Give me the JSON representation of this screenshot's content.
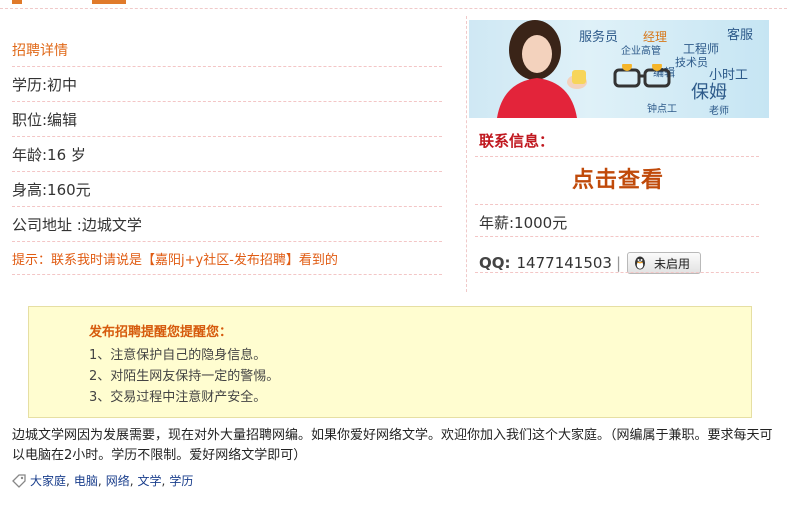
{
  "details": {
    "section_title": "招聘详情",
    "education": "学历:初中",
    "position": "职位:编辑",
    "age": "年龄:16 岁",
    "height": "身高:160元",
    "address": "公司地址 :边城文学",
    "tip_prefix": "提示：联系我时请说是",
    "tip_highlight": "【嘉阳j+y社区-发布招聘】",
    "tip_suffix": "看到的"
  },
  "banner": {
    "words": [
      "服务员",
      "经理",
      "客服",
      "工程师",
      "企业高管",
      "技术员",
      "编辑",
      "小时工",
      "保姆",
      "钟点工",
      "老师"
    ]
  },
  "contact": {
    "title": "联系信息：",
    "click_view": "点击查看",
    "salary": "年薪:1000元",
    "qq_label": "QQ:",
    "qq_number": "1477141503",
    "qq_button": "未启用"
  },
  "notice": {
    "title": "发布招聘提醒您提醒您：",
    "items": [
      "1、注意保护自己的隐身信息。",
      "2、对陌生网友保持一定的警惕。",
      "3、交易过程中注意财产安全。"
    ]
  },
  "description": "边城文学网因为发展需要，现在对外大量招聘网编。如果你爱好网络文学。欢迎你加入我们这个大家庭。（网编属于兼职。要求每天可以电脑在2小时。学历不限制。爱好网络文学即可）",
  "tags": [
    "大家庭",
    "电脑",
    "网络",
    "文学",
    "学历"
  ],
  "colors": {
    "accent": "#e06a1a",
    "red": "#c0181f",
    "notice_bg": "#fffdd0"
  }
}
